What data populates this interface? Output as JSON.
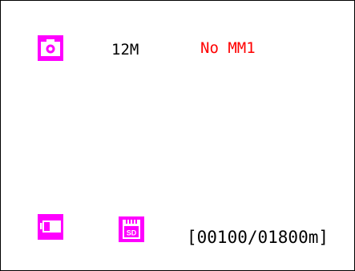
{
  "status_screen": {
    "resolution": "12M",
    "card_status": "No MM1",
    "counter": "[00100/01800m]"
  },
  "icons": {
    "mode": "camera-icon",
    "battery": "battery-icon",
    "storage": "sd-card-icon",
    "storage_label": "SD"
  },
  "colors": {
    "icon": "#ff00ff",
    "warning": "#ff0000",
    "text": "#000000",
    "background": "#ffffff"
  }
}
